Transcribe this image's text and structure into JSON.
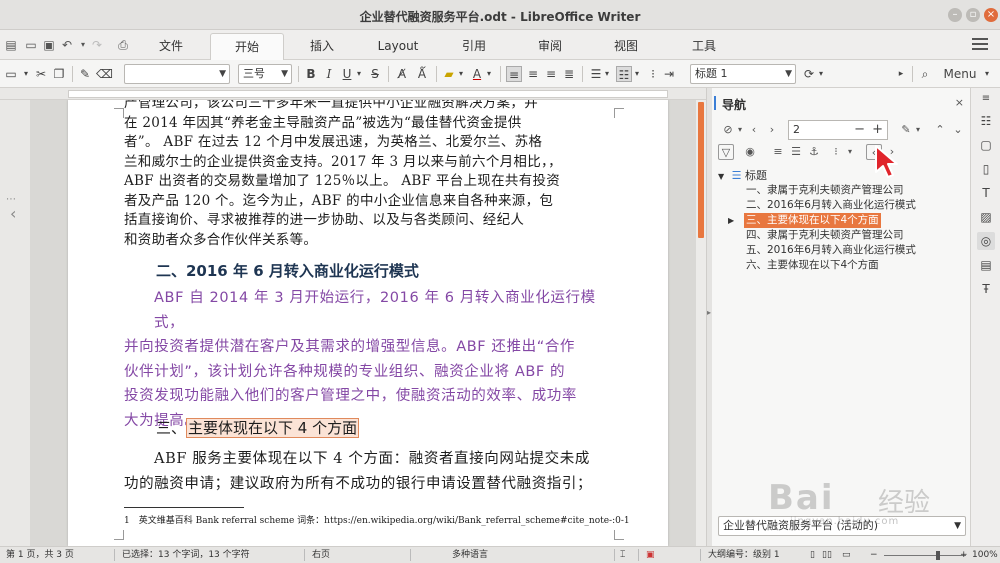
{
  "window": {
    "title": "企业替代融资服务平台.odt - LibreOffice Writer"
  },
  "tabs": [
    {
      "label": "文件"
    },
    {
      "label": "开始",
      "active": true
    },
    {
      "label": "插入"
    },
    {
      "label": "Layout"
    },
    {
      "label": "引用"
    },
    {
      "label": "审阅"
    },
    {
      "label": "视图"
    },
    {
      "label": "工具"
    }
  ],
  "toolbar": {
    "font_name": "",
    "font_size": "三号",
    "bold": "B",
    "italic": "I",
    "underline": "U",
    "strike": "S",
    "paragraph_style": "标题 1",
    "menu_label": "Menu"
  },
  "document": {
    "body_lines": [
      "产管理公司，该公司三十多年来一直提供中小企业融资解决方案，并",
      "在 2014 年因其“养老金主导融资产品”被选为“最佳替代资金提供",
      "者”。 ABF 在过去 12 个月中发展迅速，为英格兰、北爱尔兰、苏格",
      "兰和威尔士的企业提供资金支持。2017 年 3 月以来与前六个月相比，，",
      "ABF 出资者的交易数量增加了 125％以上。 ABF 平台上现在共有投资",
      "者及产品 120 个。迄今为止，ABF 的中小企业信息来自各种来源，包",
      "括直接询价、寻求被推荐的进一步协助、以及与各类顾问、经纪人",
      "和资助者众多合作伙伴关系等。"
    ],
    "heading2": "二、2016 年 6 月转入商业化运行模式",
    "purple_lines": [
      "ABF 自 2014 年 3 月开始运行，2016 年 6 月转入商业化运行模式，",
      "并向投资者提供潜在客户及其需求的增强型信息。ABF 还推出“合作",
      "伙伴计划”，该计划允许各种规模的专业组织、融资企业将 ABF 的",
      "投资发现功能融入他们的客户管理之中，使融资活动的效率、成功率",
      "大为提高。"
    ],
    "heading3_prefix": "三、",
    "heading3_highlight": "主要体现在以下 4 个方面",
    "black_lines": [
      "ABF 服务主要体现在以下 4 个方面：融资者直接向网站提交未成",
      "功的融资申请；建议政府为所有不成功的银行申请设置替代融资指引；"
    ],
    "footnote": "1　英文维基百科 Bank referral scheme 词条：https://en.wikipedia.org/wiki/Bank_referral_scheme#cite_note-:0-1"
  },
  "navigator": {
    "title": "导航",
    "page_value": "2",
    "root_label": "标题",
    "items": [
      {
        "label": "一、隶属于克利夫顿资产管理公司"
      },
      {
        "label": "二、2016年6月转入商业化运行模式"
      },
      {
        "label": "三、主要体现在以下4个方面",
        "selected": true
      },
      {
        "label": "四、隶属于克利夫顿资产管理公司"
      },
      {
        "label": "五、2016年6月转入商业化运行模式"
      },
      {
        "label": "六、主要体现在以下4个方面"
      }
    ],
    "doc_select": "企业替代融资服务平台 (活动的)"
  },
  "status": {
    "page": "第 1 页，共 3 页",
    "selection": "已选择：13 个字词，13 个字符",
    "page_style": "右页",
    "language": "多种语言",
    "outline": "大纲编号：级别 1",
    "zoom": "100%"
  },
  "watermark": {
    "brand": "Bai",
    "brand2": "经验",
    "url": "jingyan.baidu.com"
  },
  "colors": {
    "accent": "#e8773f",
    "heading": "#1e3552",
    "purple_text": "#8448a5",
    "cursor": "#e0242b"
  }
}
